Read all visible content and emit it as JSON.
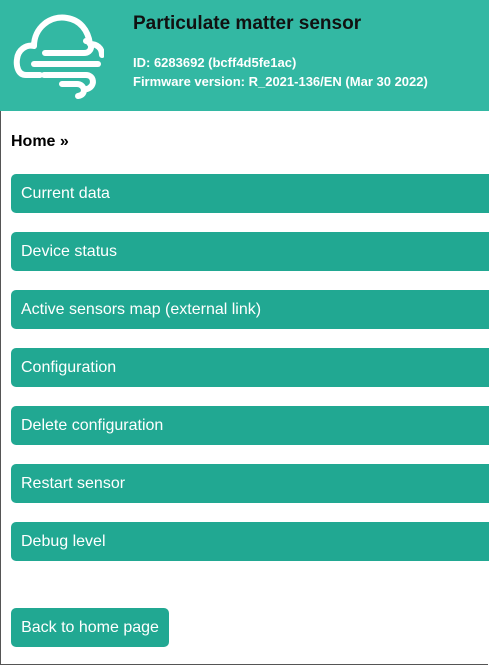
{
  "header": {
    "title": "Particulate matter sensor",
    "id_line": "ID: 6283692 (bcff4d5fe1ac)",
    "firmware_line": "Firmware version: R_2021-136/EN (Mar 30 2022)",
    "logo_icon": "cloud-wind-icon",
    "background_color": "#33b8a3"
  },
  "breadcrumb": "Home »",
  "menu": [
    {
      "label": "Current data"
    },
    {
      "label": "Device status"
    },
    {
      "label": "Active sensors map (external link)"
    },
    {
      "label": "Configuration"
    },
    {
      "label": "Delete configuration"
    },
    {
      "label": "Restart sensor"
    },
    {
      "label": "Debug level"
    }
  ],
  "back_button": "Back to home page",
  "accent_color": "#21a892"
}
